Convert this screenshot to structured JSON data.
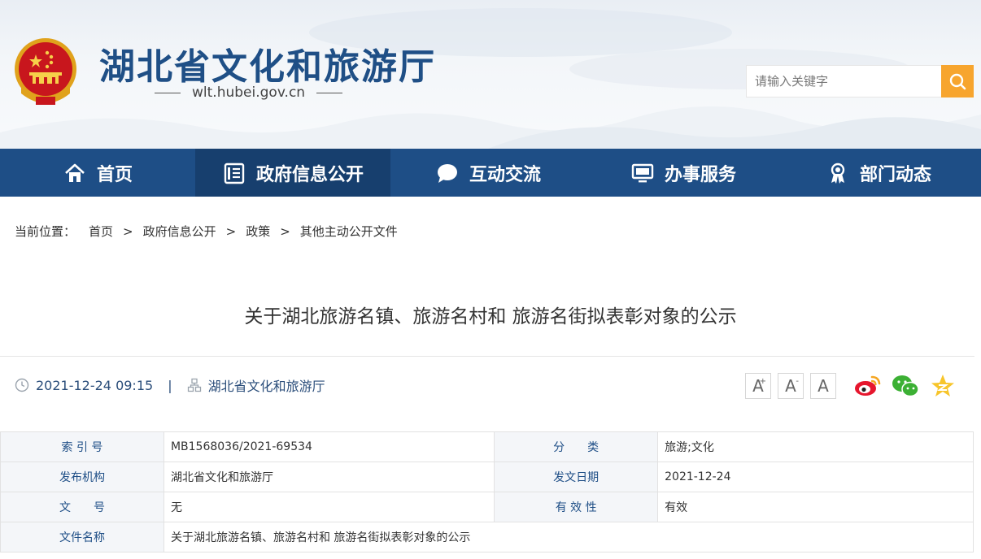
{
  "header": {
    "site_title": "湖北省文化和旅游厅",
    "site_domain": "wlt.hubei.gov.cn",
    "search_placeholder": "请输入关键字"
  },
  "nav": {
    "items": [
      {
        "label": "首页",
        "icon": "home-icon"
      },
      {
        "label": "政府信息公开",
        "icon": "document-list-icon"
      },
      {
        "label": "互动交流",
        "icon": "chat-bubble-icon"
      },
      {
        "label": "办事服务",
        "icon": "monitor-icon"
      },
      {
        "label": "部门动态",
        "icon": "award-icon"
      }
    ],
    "active_index": 1
  },
  "breadcrumb": {
    "lead": "当前位置：",
    "items": [
      "首页",
      "政府信息公开",
      "政策",
      "其他主动公开文件"
    ],
    "separator": ">"
  },
  "article": {
    "title": "关于湖北旅游名镇、旅游名村和 旅游名街拟表彰对象的公示",
    "datetime": "2021-12-24 09:15",
    "source": "湖北省文化和旅游厅"
  },
  "tools": {
    "font_larger": "A",
    "font_smaller": "A",
    "font_default": "A"
  },
  "info_table": {
    "rows": [
      {
        "k1": "索 引 号",
        "v1": "MB1568036/2021-69534",
        "k2": "分　　类",
        "v2": "旅游;文化"
      },
      {
        "k1": "发布机构",
        "v1": "湖北省文化和旅游厅",
        "k2": "发文日期",
        "v2": "2021-12-24"
      },
      {
        "k1": "文　　号",
        "v1": "无",
        "k2": "有 效 性",
        "v2": "有效"
      },
      {
        "k1": "文件名称",
        "v1": "关于湖北旅游名镇、旅游名村和 旅游名街拟表彰对象的公示"
      }
    ]
  },
  "colors": {
    "nav_bg": "#1e4e86",
    "nav_active": "#173f6e",
    "search_btn": "#f7a52e",
    "title_blue": "#1f4f86"
  }
}
